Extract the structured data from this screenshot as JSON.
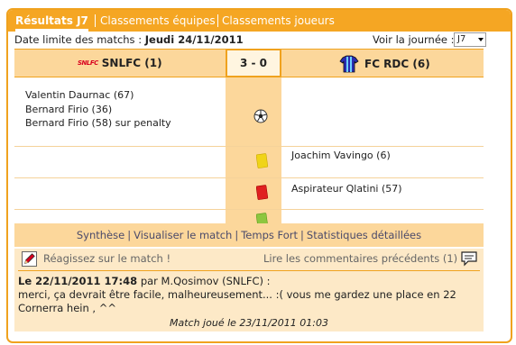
{
  "tabs": [
    {
      "label": "Résultats J7",
      "active": true
    },
    {
      "label": "Classements équipes",
      "active": false
    },
    {
      "label": "Classements joueurs",
      "active": false
    }
  ],
  "deadline": {
    "label": "Date limite des matchs :",
    "value": "Jeudi 24/11/2011"
  },
  "round_selector": {
    "label": "Voir la journée :",
    "value": "J7"
  },
  "match": {
    "home_team": "SNLFC (1)",
    "home_logo_text": "SNLFC",
    "away_team": "FC RDC (6)",
    "score": "3 - 0"
  },
  "events": [
    {
      "home": "Valentin Daurnac (67)",
      "away": ""
    },
    {
      "home": "Bernard Firio (36)",
      "away": ""
    },
    {
      "home": "Bernard Firio (58) sur penalty",
      "away": ""
    },
    {
      "home": "",
      "away": "Joachim Vavingo (6)"
    },
    {
      "home": "",
      "away": "Aspirateur Qlatini (57)"
    }
  ],
  "links": [
    "Synthèse",
    "Visualiser le match",
    "Temps Fort",
    "Statistiques détaillées"
  ],
  "link_separator": "|",
  "reaction": {
    "react_label": "Réagissez sur le match !",
    "previous_comments_label": "Lire les commentaires précédents (1)"
  },
  "comment": {
    "date": "Le 22/11/2011 17:48",
    "by_label": "par",
    "author": "M.Qosimov (SNLFC) :",
    "text": "merci, ça devrait être facile, malheureusement... :( vous me gardez une place en 22 Cornerra hein , ^^"
  },
  "match_played": "Match joué le 23/11/2011 01:03",
  "colors": {
    "accent": "#f5a623",
    "light": "#fcd79b",
    "comment_bg": "#fde9c7"
  }
}
